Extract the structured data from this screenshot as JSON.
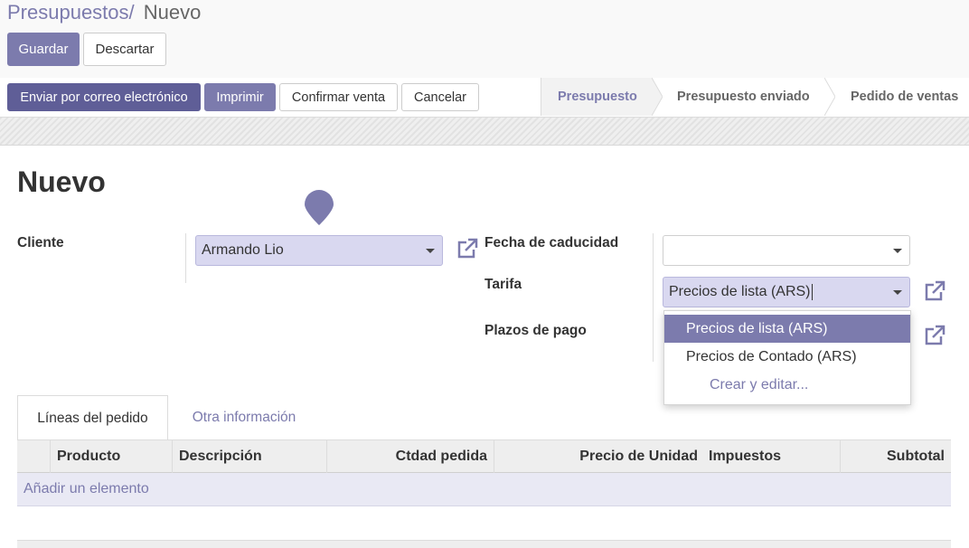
{
  "breadcrumb": {
    "parent": "Presupuestos",
    "separator": "/",
    "current": "Nuevo"
  },
  "actions": {
    "save": "Guardar",
    "discard": "Descartar"
  },
  "statusbar": {
    "buttons": {
      "email": "Enviar por correo electrónico",
      "print": "Imprimir",
      "confirm": "Confirmar venta",
      "cancel": "Cancelar"
    },
    "stages": [
      "Presupuesto",
      "Presupuesto enviado",
      "Pedido de ventas"
    ],
    "active_stage": "Presupuesto"
  },
  "form": {
    "title": "Nuevo",
    "customer": {
      "label": "Cliente",
      "value": "Armando Lio"
    },
    "expiration": {
      "label": "Fecha de caducidad",
      "value": ""
    },
    "pricelist": {
      "label": "Tarifa",
      "value": "Precios de lista (ARS)"
    },
    "payment_terms": {
      "label": "Plazos de pago",
      "value": ""
    }
  },
  "pricelist_dropdown": {
    "options": [
      "Precios de lista (ARS)",
      "Precios de Contado (ARS)"
    ],
    "selected": "Precios de lista (ARS)",
    "create_edit": "Crear y editar..."
  },
  "tabs": {
    "order_lines": "Líneas del pedido",
    "other_info": "Otra información"
  },
  "table": {
    "columns": {
      "product": "Producto",
      "description": "Descripción",
      "qty": "Ctdad pedida",
      "unit_price": "Precio de Unidad",
      "taxes": "Impuestos",
      "subtotal": "Subtotal"
    },
    "add_line": "Añadir un elemento"
  },
  "colors": {
    "brand": "#7c7bad",
    "brand_dark": "#5f5e97",
    "selection": "#d9d8f0"
  },
  "icons": {
    "external_link": "external-link-icon",
    "caret": "caret-down-icon",
    "map_pin": "map-pin-icon"
  }
}
